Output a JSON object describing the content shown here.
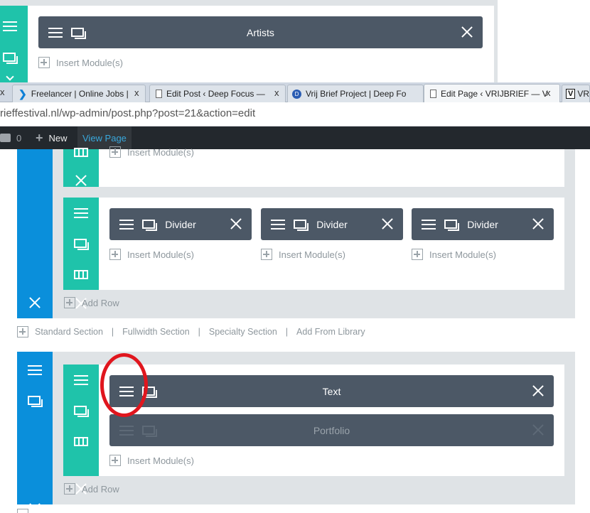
{
  "top_fragment": {
    "module_title": "Artists",
    "insert_label": "Insert Module(s)"
  },
  "browser": {
    "tabs": [
      {
        "label": "Freelancer | Online Jobs |",
        "icon": "freelancer-icon"
      },
      {
        "label": "Edit Post ‹ Deep Focus —",
        "icon": "page-icon"
      },
      {
        "label": "Vrij Brief Project | Deep Fo",
        "icon": "d-logo-icon"
      },
      {
        "label": "Edit Page ‹ VRIJBRIEF — V",
        "icon": "page-icon"
      },
      {
        "label": "VR",
        "icon": "v-logo-icon"
      }
    ],
    "url": "rieffestival.nl/wp-admin/post.php?post=21&action=edit"
  },
  "admin_bar": {
    "comments_count": "0",
    "new_label": "New",
    "view_page_label": "View Page"
  },
  "section1": {
    "row_top_insert": "Insert Module(s)",
    "modules": [
      {
        "title": "Divider",
        "insert": "Insert Module(s)"
      },
      {
        "title": "Divider",
        "insert": "Insert Module(s)"
      },
      {
        "title": "Divider",
        "insert": "Insert Module(s)"
      }
    ],
    "add_row": "Add Row"
  },
  "section_links": {
    "standard": "Standard Section",
    "fullwidth": "Fullwidth Section",
    "specialty": "Specialty Section",
    "library": "Add From Library",
    "separator": "|"
  },
  "section2": {
    "module_text": "Text",
    "module_portfolio": "Portfolio",
    "insert": "Insert Module(s)",
    "add_row": "Add Row"
  },
  "colors": {
    "section_blue": "#0a8fdb",
    "row_teal": "#1fc3aa",
    "module_gray": "#4c5866",
    "annotation_red": "#e0161e"
  }
}
